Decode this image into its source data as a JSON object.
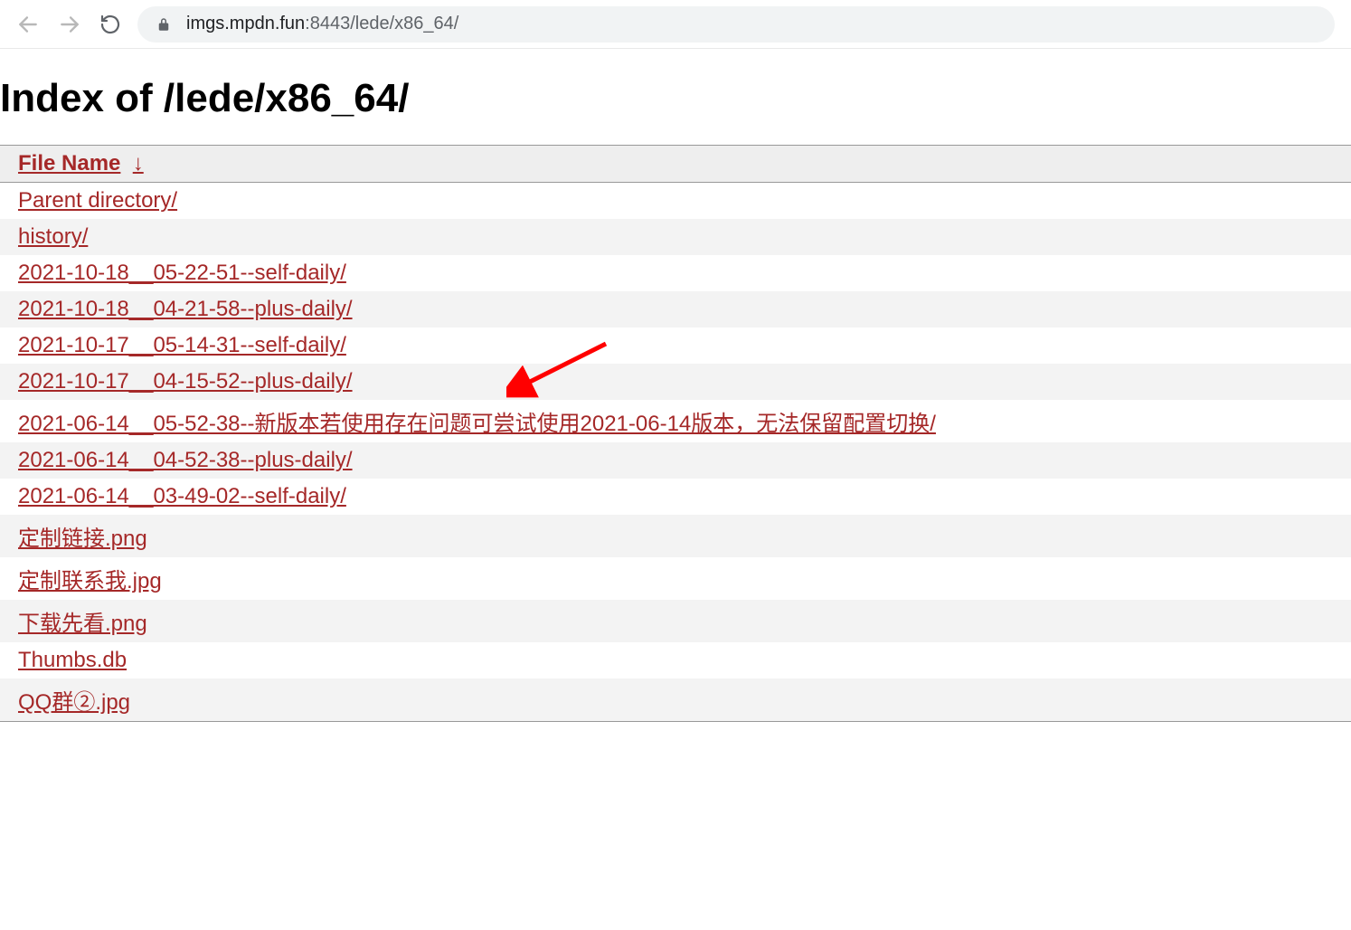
{
  "browser": {
    "url_host": "imgs.mpdn.fun",
    "url_port": ":8443",
    "url_path": "/lede/x86_64/"
  },
  "page": {
    "title": "Index of /lede/x86_64/",
    "header_filename": "File Name",
    "header_sort": "↓"
  },
  "rows": [
    {
      "name": "Parent directory/"
    },
    {
      "name": "history/"
    },
    {
      "name": "2021-10-18__05-22-51--self-daily/"
    },
    {
      "name": "2021-10-18__04-21-58--plus-daily/"
    },
    {
      "name": "2021-10-17__05-14-31--self-daily/"
    },
    {
      "name": "2021-10-17__04-15-52--plus-daily/"
    },
    {
      "name": "2021-06-14__05-52-38--新版本若使用存在问题可尝试使用2021-06-14版本，无法保留配置切换/"
    },
    {
      "name": "2021-06-14__04-52-38--plus-daily/"
    },
    {
      "name": "2021-06-14__03-49-02--self-daily/"
    },
    {
      "name": "定制链接.png"
    },
    {
      "name": "定制联系我.jpg"
    },
    {
      "name": "下载先看.png"
    },
    {
      "name": "Thumbs.db"
    },
    {
      "name": "QQ群②.jpg"
    }
  ],
  "annotation": {
    "arrow_target_row_index": 3
  }
}
